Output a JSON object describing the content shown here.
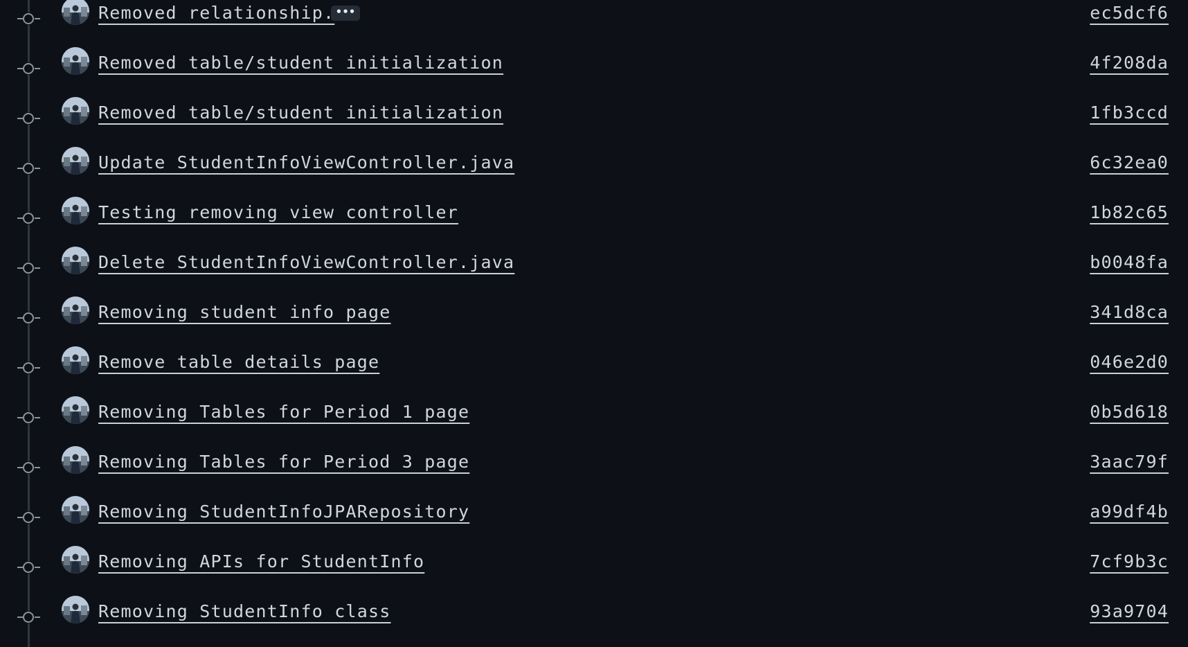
{
  "commits": [
    {
      "message": "Removed relationship.",
      "sha": "ec5dcf6",
      "has_more": true,
      "more_label": "•••"
    },
    {
      "message": "Removed table/student initialization",
      "sha": "4f208da"
    },
    {
      "message": "Removed table/student initialization",
      "sha": "1fb3ccd"
    },
    {
      "message": "Update StudentInfoViewController.java",
      "sha": "6c32ea0"
    },
    {
      "message": "Testing removing view controller",
      "sha": "1b82c65"
    },
    {
      "message": "Delete StudentInfoViewController.java",
      "sha": "b0048fa"
    },
    {
      "message": "Removing student info page",
      "sha": "341d8ca"
    },
    {
      "message": "Remove table details page",
      "sha": "046e2d0"
    },
    {
      "message": "Removing Tables for Period 1 page",
      "sha": "0b5d618"
    },
    {
      "message": "Removing Tables for Period 3 page",
      "sha": "3aac79f"
    },
    {
      "message": "Removing StudentInfoJPARepository",
      "sha": "a99df4b"
    },
    {
      "message": "Removing APIs for StudentInfo",
      "sha": "7cf9b3c"
    },
    {
      "message": "Removing StudentInfo class",
      "sha": "93a9704"
    }
  ],
  "colors": {
    "background": "#0d1117",
    "text": "#d2d7dd",
    "timeline": "#30363d",
    "node": "#8b949e"
  }
}
